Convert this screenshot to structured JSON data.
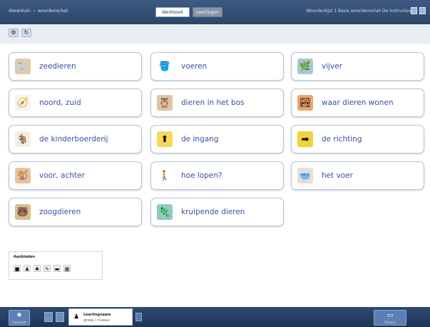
{
  "topbar": {
    "breadcrumb": [
      "dierentuin",
      "woordenschat"
    ],
    "breadcrumb_separator": "›",
    "tabs": [
      {
        "label": "Werkboek",
        "active": true
      },
      {
        "label": "Leerlingen",
        "active": false
      }
    ],
    "right_text": "Woordenlijst 1 Basis woordenschat De Instructeur"
  },
  "subtoolbar": {
    "buttons": [
      {
        "icon": "gear-icon",
        "glyph": "⚙"
      },
      {
        "icon": "refresh-icon",
        "glyph": "↻"
      }
    ]
  },
  "cards": [
    {
      "label": "zeedieren",
      "icon": "seal-picture-icon",
      "glyph": "🦭",
      "bg": "#e3c9a8"
    },
    {
      "label": "voeren",
      "icon": "feeding-bucket-icon",
      "glyph": "🪣",
      "bg": "#ffffff"
    },
    {
      "label": "vijver",
      "icon": "pond-icon",
      "glyph": "🌿",
      "bg": "#a9c7d8"
    },
    {
      "label": "noord, zuid",
      "icon": "compass-icon",
      "glyph": "🧭",
      "bg": "#f3f3f3"
    },
    {
      "label": "dieren in het bos",
      "icon": "forest-animal-icon",
      "glyph": "🦉",
      "bg": "#d9c6a5"
    },
    {
      "label": "waar dieren wonen",
      "icon": "habitat-icon",
      "glyph": "🏞",
      "bg": "#e9a66a"
    },
    {
      "label": "de kinderboerderij",
      "icon": "petting-farm-icon",
      "glyph": "🐐",
      "bg": "#f4efe6"
    },
    {
      "label": "de ingang",
      "icon": "entrance-icon",
      "glyph": "⬆",
      "bg": "#f6d95c"
    },
    {
      "label": "de richting",
      "icon": "direction-sign-icon",
      "glyph": "➡",
      "bg": "#f2d33b"
    },
    {
      "label": "voor, achter",
      "icon": "front-back-icon",
      "glyph": "🐒",
      "bg": "#e8c3a0"
    },
    {
      "label": "hoe lopen?",
      "icon": "walking-icon",
      "glyph": "🚶",
      "bg": "#ffffff"
    },
    {
      "label": "het voer",
      "icon": "animal-food-icon",
      "glyph": "🥣",
      "bg": "#e9ded0"
    },
    {
      "label": "zoogdieren",
      "icon": "mammal-icon",
      "glyph": "🐻",
      "bg": "#d8c08c"
    },
    {
      "label": "kruipende dieren",
      "icon": "reptile-icon",
      "glyph": "🦎",
      "bg": "#8ec9c2"
    }
  ],
  "panel": {
    "title": "Aanbieden",
    "icons": [
      {
        "name": "stop-icon",
        "glyph": "■"
      },
      {
        "name": "person-icon",
        "glyph": "♟"
      },
      {
        "name": "group-icon",
        "glyph": "♣"
      },
      {
        "name": "pencil-icon",
        "glyph": "✎"
      },
      {
        "name": "screen-icon",
        "glyph": "▬"
      },
      {
        "name": "grid-icon",
        "glyph": "▦"
      }
    ]
  },
  "bottombar": {
    "home_label": "Overzicht",
    "home_glyph": "★",
    "user_name": "Leerlingnaam",
    "user_role": "groep / niveau",
    "right_label": "Scherm",
    "right_glyph": "▭"
  }
}
